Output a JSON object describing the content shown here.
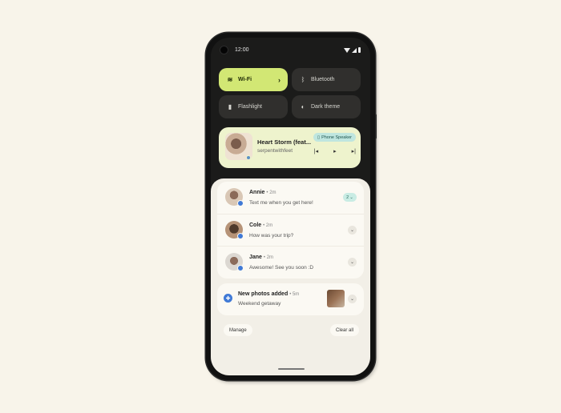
{
  "status_bar": {
    "time": "12:00",
    "icons": [
      "wifi-icon",
      "cellular-signal-icon",
      "battery-icon"
    ]
  },
  "quick_settings": {
    "tiles": [
      {
        "label": "Wi-Fi",
        "icon": "wifi-icon",
        "active": true,
        "has_chevron": true
      },
      {
        "label": "Bluetooth",
        "icon": "bluetooth-icon",
        "active": false
      },
      {
        "label": "Flashlight",
        "icon": "flashlight-icon",
        "active": false
      },
      {
        "label": "Dark theme",
        "icon": "dark-theme-icon",
        "active": false
      }
    ]
  },
  "media_player": {
    "title": "Heart Storm (feat...",
    "artist": "serpentwithfeet",
    "output_device": "Phone Speaker",
    "controls": [
      "previous",
      "play",
      "next"
    ]
  },
  "notifications": {
    "conversations": [
      {
        "name": "Annie",
        "time": "2m",
        "message": "Text me when you get here!",
        "count": "2"
      },
      {
        "name": "Cole",
        "time": "2m",
        "message": "How was your trip?"
      },
      {
        "name": "Jane",
        "time": "2m",
        "message": "Awesome! See you soon :D"
      }
    ],
    "photos": {
      "title": "New photos added",
      "time": "5m",
      "body": "Weekend getaway"
    },
    "manage_label": "Manage",
    "clear_all_label": "Clear all"
  },
  "colors": {
    "background": "#f8f4ea",
    "accent_tile": "#d2e774",
    "media_bg": "#eef3cd",
    "chip": "#bfe6df",
    "app_badge": "#3f79d6"
  }
}
